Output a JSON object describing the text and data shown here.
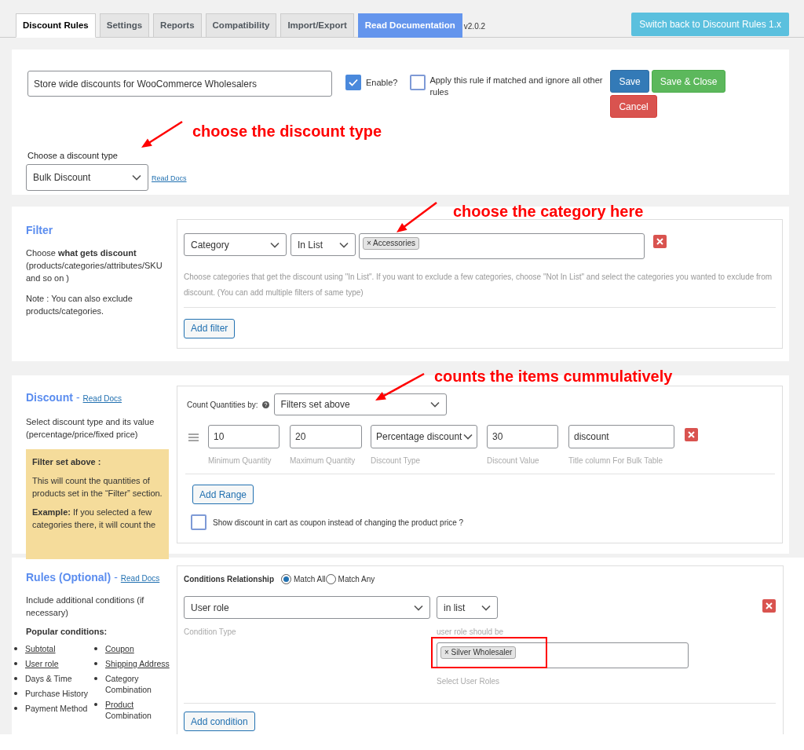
{
  "tabs": [
    {
      "label": "Discount Rules",
      "selected": true
    },
    {
      "label": "Settings",
      "selected": false
    },
    {
      "label": "Reports",
      "selected": false
    },
    {
      "label": "Compatibility",
      "selected": false
    },
    {
      "label": "Import/Export",
      "selected": false
    }
  ],
  "doc_link": "Read Documentation",
  "version": "v2.0.2",
  "switch_button": "Switch back to Discount Rules 1.x",
  "rule": {
    "title_value": "Store wide discounts for WooCommerce Wholesalers",
    "enable": {
      "label": "Enable?",
      "checked": true
    },
    "exclusive": {
      "label": "Apply this rule if matched and ignore all other rules",
      "checked": false
    },
    "buttons": [
      {
        "label": "Save",
        "kind": "primary"
      },
      {
        "label": "Save & Close",
        "kind": "success"
      },
      {
        "label": "Cancel",
        "kind": "danger"
      }
    ],
    "type_label": "Choose a discount type",
    "type_value": "Bulk Discount",
    "type_link": "Read Docs"
  },
  "filter": {
    "title": "Filter",
    "description": "Choose **what gets discount** (products/categories/attributes/SKU and so on )",
    "note": "Note : You can also exclude products/categories.",
    "rows": [
      {
        "field": "Category",
        "operator": "In List",
        "tags": [
          "× Accessories"
        ]
      }
    ],
    "help": "Choose categories that get the discount using \"In List\". If you want to exclude a few categories, choose \"Not In List\" and select the categories you wanted to exclude from discount. (You can add multiple filters of same type)",
    "add_button": "Add filter"
  },
  "discount": {
    "title": "Discount",
    "separator": "-",
    "link": "Read Docs",
    "description": "Select discount type and its value (percentage/price/fixed price)",
    "info": [
      "**Filter set above :**",
      "This will count the quantities of products set in the “Filter” section.",
      "**Example:** If you selected a few categories there, it will count the"
    ],
    "count_label": "Count Quantities by:",
    "count_value": "Filters set above",
    "ranges": [
      {
        "min": "10",
        "min_label": "Minimum Quantity",
        "max": "20",
        "max_label": "Maximum Quantity",
        "type": "Percentage discount",
        "type_label": "Discount Type",
        "value": "30",
        "value_label": "Discount Value",
        "title": "discount",
        "title_label": "Title column For Bulk Table"
      }
    ],
    "add_button": "Add Range",
    "coupon": {
      "label": "Show discount in cart as coupon instead of changing the product price ?",
      "checked": false
    }
  },
  "rules": {
    "title": "Rules (Optional)",
    "separator": "-",
    "link": "Read Docs",
    "description": "Include additional conditions (if necessary)",
    "popular_label": "Popular conditions:",
    "popular": [
      [
        {
          "text": "Subtotal",
          "linked": true
        },
        {
          "text": "User role",
          "linked": true
        },
        {
          "text": "Days & Time",
          "linked": false
        },
        {
          "text": "Purchase History",
          "linked": false
        },
        {
          "text": "Payment Method",
          "linked": false
        }
      ],
      [
        {
          "text": "Coupon",
          "linked": true
        },
        {
          "text": "Shipping Address",
          "linked": true
        },
        {
          "text": "Category Combination",
          "linked": false
        },
        {
          "text": "Product",
          "linked": true,
          "suffix": "Combination"
        }
      ]
    ],
    "relationship_label": "Conditions Relationship",
    "relationship": [
      {
        "label": "Match All",
        "selected": true
      },
      {
        "label": "Match Any",
        "selected": false
      }
    ],
    "conditions": [
      {
        "type": "User role",
        "type_label": "Condition Type",
        "operator": "in list",
        "operator_label": "user role should be",
        "tags": [
          {
            "label": "× Silver Wholesaler",
            "highlighted": true
          }
        ],
        "tags_label": "Select User Roles"
      }
    ],
    "add_button": "Add condition"
  },
  "annotations": [
    "choose the discount type",
    "choose the category here",
    "counts the items cummulatively"
  ]
}
